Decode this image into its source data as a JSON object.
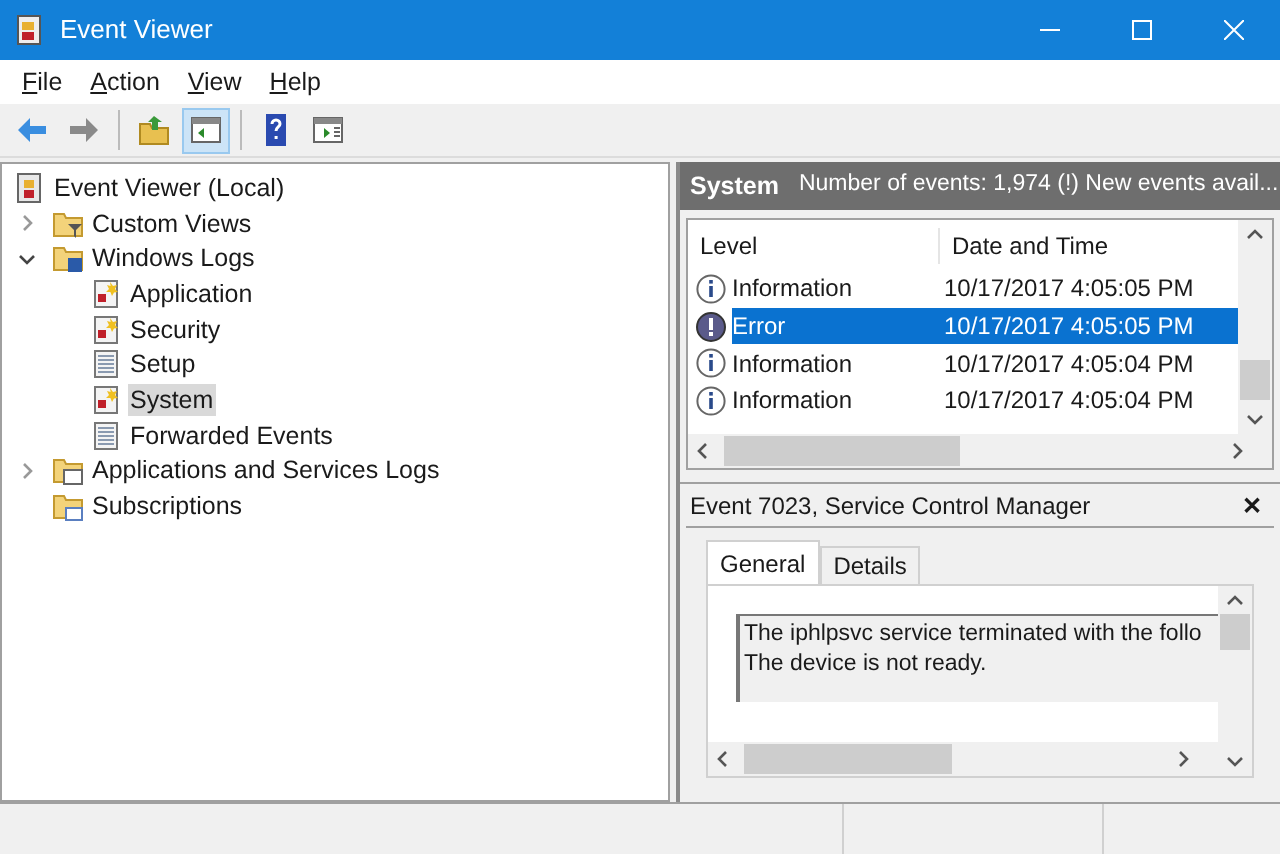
{
  "window": {
    "title": "Event Viewer"
  },
  "menu": [
    {
      "label": "File"
    },
    {
      "label": "Action"
    },
    {
      "label": "View"
    },
    {
      "label": "Help"
    }
  ],
  "toolbar": [
    {
      "kind": "back",
      "pressed": false
    },
    {
      "kind": "forward",
      "pressed": false
    },
    {
      "kind": "sep"
    },
    {
      "kind": "up-folder",
      "pressed": false
    },
    {
      "kind": "console-tree",
      "pressed": true
    },
    {
      "kind": "sep"
    },
    {
      "kind": "help",
      "pressed": false
    },
    {
      "kind": "action-pane",
      "pressed": false
    }
  ],
  "tree": [
    {
      "label": "Event Viewer (Local)",
      "kind": "root",
      "selected": false,
      "children": [
        {
          "label": "Custom Views",
          "kind": "filter-folder",
          "expanded": false,
          "selected": false
        },
        {
          "label": "Windows Logs",
          "kind": "logs-folder",
          "expanded": true,
          "selected": false,
          "children": [
            {
              "label": "Application",
              "kind": "log",
              "selected": false
            },
            {
              "label": "Security",
              "kind": "log",
              "selected": false
            },
            {
              "label": "Setup",
              "kind": "plain-log",
              "selected": false
            },
            {
              "label": "System",
              "kind": "log",
              "selected": true
            },
            {
              "label": "Forwarded Events",
              "kind": "plain-log",
              "selected": false
            }
          ]
        },
        {
          "label": "Applications and Services Logs",
          "kind": "folder",
          "expanded": false,
          "selected": false
        },
        {
          "label": "Subscriptions",
          "kind": "sub-folder",
          "selected": false
        }
      ]
    }
  ],
  "log_header": {
    "name": "System",
    "summary": "Number of events: 1,974 (!) New events avail..."
  },
  "events": {
    "columns": [
      "Level",
      "Date and Time"
    ],
    "rows": [
      {
        "kind": "info",
        "level": "Information",
        "date": "10/17/2017 4:05:05 PM",
        "selected": false
      },
      {
        "kind": "error",
        "level": "Error",
        "date": "10/17/2017 4:05:05 PM",
        "selected": true
      },
      {
        "kind": "info",
        "level": "Information",
        "date": "10/17/2017 4:05:04 PM",
        "selected": false
      },
      {
        "kind": "info",
        "level": "Information",
        "date": "10/17/2017 4:05:04 PM",
        "selected": false
      }
    ]
  },
  "detail": {
    "title": "Event 7023, Service Control Manager",
    "close": "✕",
    "tabs": [
      {
        "label": "General",
        "selected": true
      },
      {
        "label": "Details",
        "selected": false
      }
    ],
    "lines": [
      "The iphlpsvc service terminated with the follo",
      "The device is not ready."
    ]
  }
}
